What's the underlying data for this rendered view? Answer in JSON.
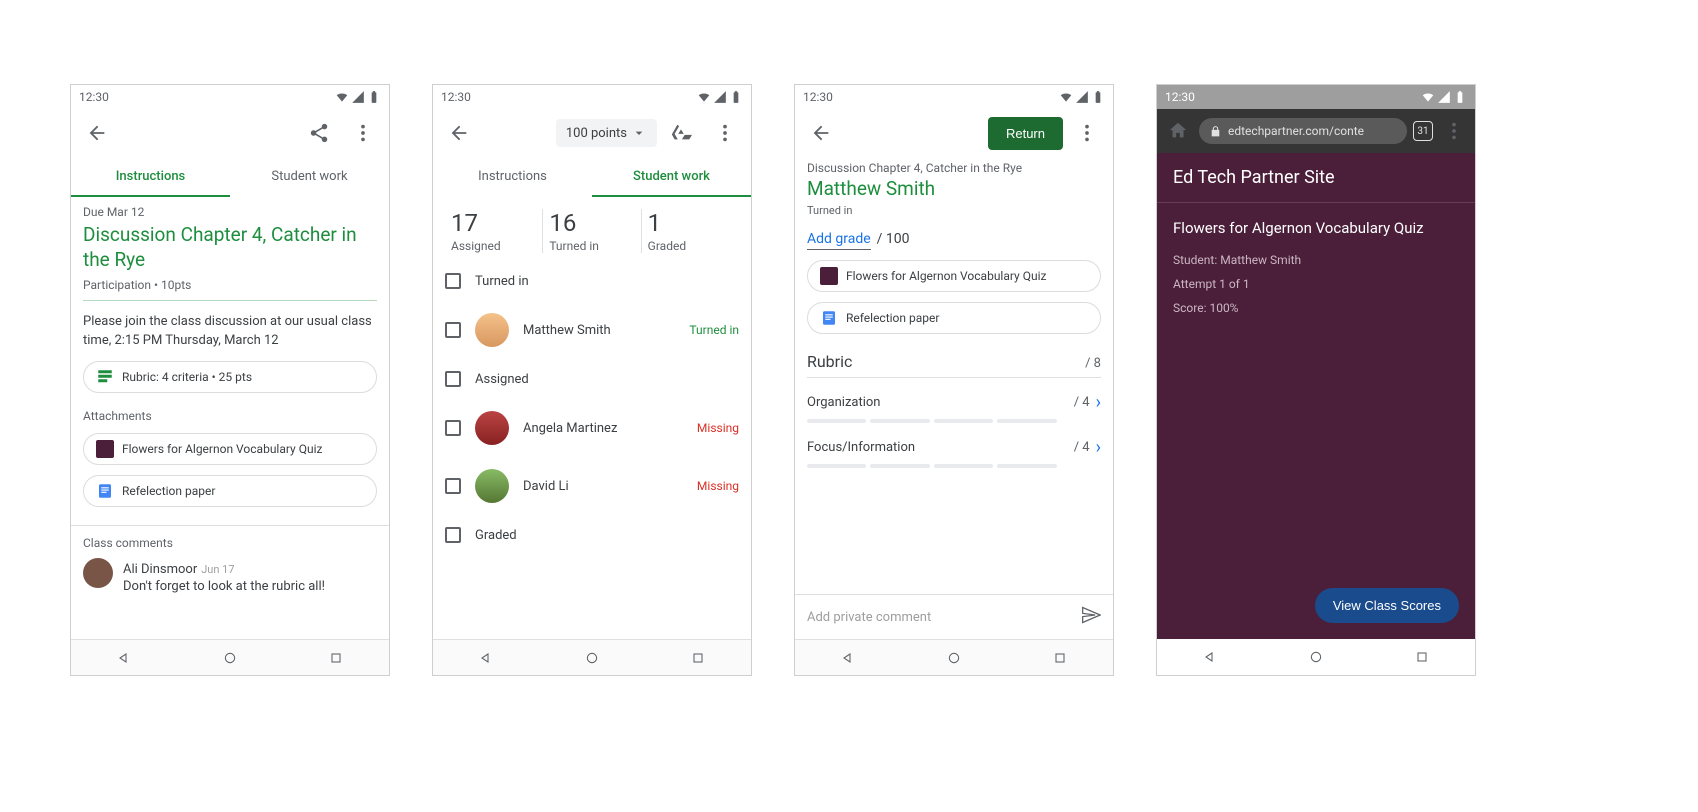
{
  "common": {
    "time": "12:30"
  },
  "s1": {
    "tabs": {
      "instructions": "Instructions",
      "studentwork": "Student work"
    },
    "due": "Due Mar 12",
    "title": "Discussion Chapter 4, Catcher in the Rye",
    "meta": "Participation • 10pts",
    "body": "Please join the class discussion at our usual class time, 2:15 PM Thursday, March 12",
    "rubric_chip": "Rubric: 4 criteria • 25 pts",
    "attachments_label": "Attachments",
    "attach1": "Flowers for Algernon Vocabulary Quiz",
    "attach2": "Refelection paper",
    "comments_label": "Class comments",
    "commenter": "Ali Dinsmoor",
    "comment_date": "Jun 17",
    "comment_text": "Don't forget to look at the rubric all!"
  },
  "s2": {
    "points": "100 points",
    "tabs": {
      "instructions": "Instructions",
      "studentwork": "Student work"
    },
    "stats": [
      {
        "num": "17",
        "label": "Assigned"
      },
      {
        "num": "16",
        "label": "Turned in"
      },
      {
        "num": "1",
        "label": "Graded"
      }
    ],
    "groups": {
      "turnedin": "Turned in",
      "assigned": "Assigned",
      "graded": "Graded"
    },
    "students": [
      {
        "name": "Matthew Smith",
        "status": "Turned in",
        "status_class": "turned"
      },
      {
        "name": "Angela Martinez",
        "status": "Missing",
        "status_class": "missing"
      },
      {
        "name": "David Li",
        "status": "Missing",
        "status_class": "missing"
      }
    ]
  },
  "s3": {
    "return": "Return",
    "context": "Discussion Chapter 4, Catcher in the Rye",
    "student": "Matthew Smith",
    "turnedin": "Turned in",
    "add_grade": "Add grade",
    "grade_of": "/ 100",
    "attach1": "Flowers for Algernon Vocabulary Quiz",
    "attach2": "Refelection paper",
    "rubric_label": "Rubric",
    "rubric_total": "/ 8",
    "criteria": [
      {
        "name": "Organization",
        "points": "/ 4"
      },
      {
        "name": "Focus/Information",
        "points": "/ 4"
      }
    ],
    "comment_placeholder": "Add private comment"
  },
  "s4": {
    "url": "edtechpartner.com/conte",
    "tabcount": "31",
    "site_title": "Ed Tech Partner Site",
    "quiz_title": "Flowers for Algernon Vocabulary Quiz",
    "student_line": "Student: Matthew Smith",
    "attempt_line": "Attempt 1 of 1",
    "score_line": "Score: 100%",
    "view_btn": "View Class Scores"
  }
}
